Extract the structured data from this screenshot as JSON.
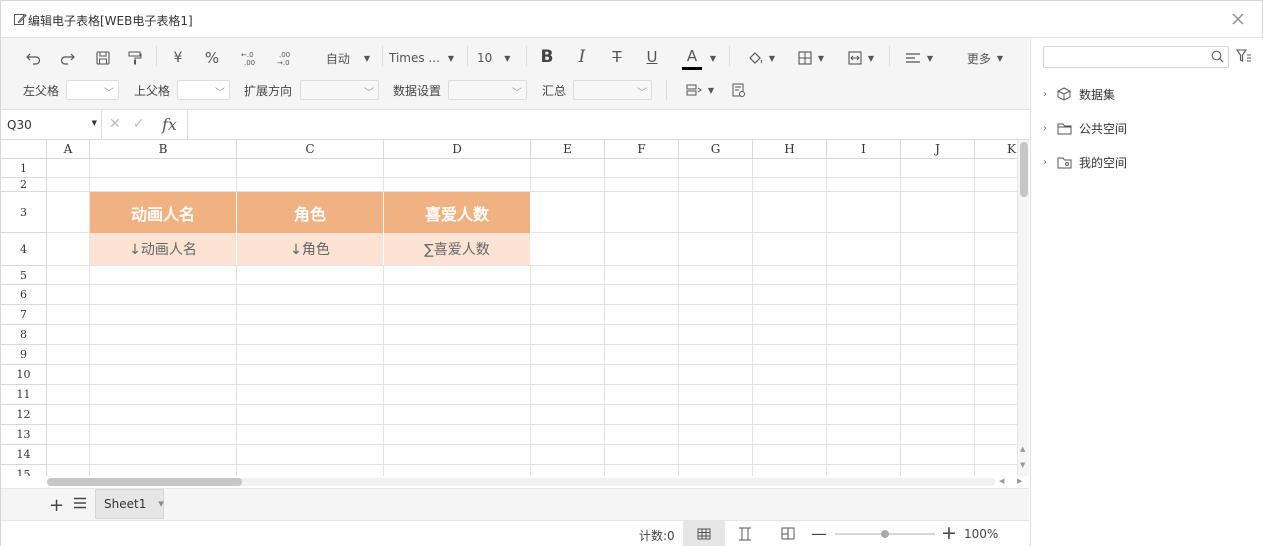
{
  "window": {
    "title": "编辑电子表格[WEB电子表格1]"
  },
  "toolbar": {
    "format_auto": "自动",
    "font_name": "Times ...",
    "font_size": "10",
    "more": "更多",
    "currency": "¥",
    "percent": "%",
    "inc_decimal": ".0\n.00",
    "dec_decimal": ".00\n.0",
    "bold": "B",
    "italic": "I",
    "strike": "T",
    "underline": "U",
    "font_color": "A",
    "font_color_value": "#000000"
  },
  "row2": {
    "left_parent": "左父格",
    "up_parent": "上父格",
    "expand_dir": "扩展方向",
    "data_setting": "数据设置",
    "summary": "汇总"
  },
  "formula_bar": {
    "cell_ref": "Q30",
    "fx": "fx"
  },
  "grid": {
    "columns": [
      "A",
      "B",
      "C",
      "D",
      "E",
      "F",
      "G",
      "H",
      "I",
      "J",
      "K"
    ],
    "rows": [
      "1",
      "2",
      "3",
      "4",
      "5",
      "6",
      "7",
      "8",
      "9",
      "10",
      "11",
      "12",
      "13",
      "14",
      "15"
    ],
    "header_row": [
      "动画人名",
      "角色",
      "喜爱人数"
    ],
    "field_row": [
      "↓动画人名",
      "↓角色",
      "∑喜爱人数"
    ],
    "header_color": "#f0b183",
    "field_color": "#fbe3d3"
  },
  "sheets": {
    "tabs": [
      "Sheet1"
    ]
  },
  "status": {
    "count": "计数:0",
    "zoom": "100%",
    "zoom_level": 0.5
  },
  "tree": {
    "items": [
      {
        "label": "数据集",
        "icon": "cube-icon"
      },
      {
        "label": "公共空间",
        "icon": "folder-icon"
      },
      {
        "label": "我的空间",
        "icon": "user-folder-icon"
      }
    ]
  }
}
